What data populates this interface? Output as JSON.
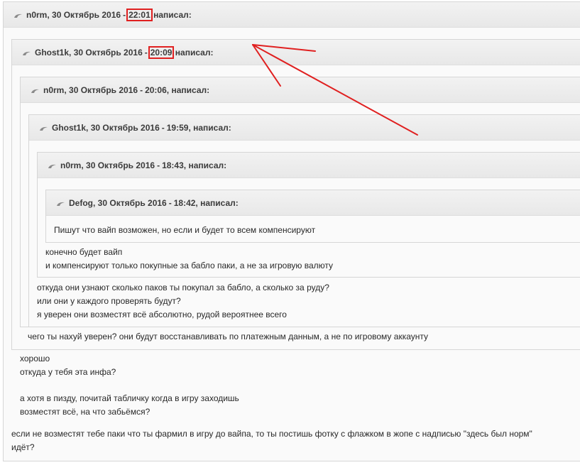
{
  "quotes": [
    {
      "author": "n0rm",
      "date": "30 Октябрь 2016",
      "time": "22:01",
      "suffix": "написал:"
    },
    {
      "author": "Ghost1k",
      "date": "30 Октябрь 2016",
      "time": "20:09",
      "suffix": "написал:"
    },
    {
      "author": "n0rm",
      "date": "30 Октябрь 2016",
      "time": "20:06,",
      "suffix": "написал:"
    },
    {
      "author": "Ghost1k",
      "date": "30 Октябрь 2016",
      "time": "19:59,",
      "suffix": "написал:"
    },
    {
      "author": "n0rm",
      "date": "30 Октябрь 2016",
      "time": "18:43,",
      "suffix": "написал:"
    },
    {
      "author": "Defog",
      "date": "30 Октябрь 2016",
      "time": "18:42,",
      "suffix": "написал:"
    }
  ],
  "texts": {
    "defog": "Пишут что вайп возможен, но если и будет то всем компенсируют",
    "n0rm_1": "конечно будет вайп",
    "n0rm_2": "и компенсируют только покупные за бабло паки, а не за игровую валюту",
    "ghost_1": "откуда они узнают сколько паков ты покупал за бабло, а сколько за руду?",
    "ghost_2": "или они у каждого проверять будут?",
    "ghost_3": "я уверен они возместят всё абсолютно, рудой вероятнее всего",
    "n0rm_3": "чего ты нахуй уверен? они будут восстанавливать по платежным данным, а не по игровому аккаунту",
    "ghost_4": "хорошо",
    "ghost_5": "откуда у тебя эта инфа?",
    "ghost_6": "а хотя в пизду, почитай табличку когда в игру заходишь",
    "ghost_7": "возместят всё, на что забьёмся?",
    "n0rm_4": "если не возместят тебе паки что ты фармил в игру до вайпа, то ты постишь фотку с флажком в жопе с надписью \"здесь был норм\"",
    "n0rm_5": "идёт?"
  },
  "annotation": {
    "color": "#e02020"
  },
  "icons": {
    "quote": "quote-arrow-icon"
  }
}
